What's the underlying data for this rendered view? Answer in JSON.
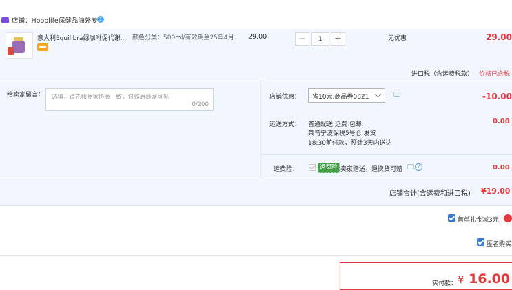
{
  "shop": {
    "name": "店铺：Hooplife保健品海外专",
    "badge": "1"
  },
  "product": {
    "title": "意大利Equilibra绿咖啡促代谢...",
    "sku": "颜色分类：500ml/有效期至25年4月",
    "unit_price": "29.00",
    "quantity": "1",
    "qty_minus": "−",
    "qty_plus": "+",
    "promotion": "无优惠",
    "total": "29.00"
  },
  "tax": {
    "label": "进口税（含运费税款）",
    "status": "价格已含税"
  },
  "message": {
    "label": "给卖家留言：",
    "placeholder": "选填，请先和商家协商一致，付款后商家可见",
    "counter": "0/200"
  },
  "coupon": {
    "label": "店铺优惠：",
    "selected": "省10元:商品券0821",
    "amount": "-10.00"
  },
  "shipping": {
    "label": "运送方式：",
    "lines": [
      "普通配送 运费 包邮",
      "菜鸟宁波保税5号仓 发货",
      "18:30前付款，预计3天内送达"
    ],
    "amount": "0.00"
  },
  "insurance": {
    "label": "运费险：",
    "tag": "运费险",
    "text": "卖家赠送，退换货可赔",
    "amount": "0.00"
  },
  "shop_total": {
    "label": "店铺合计(含运费和进口税)",
    "value": "¥19.00"
  },
  "options": {
    "gift_label": "首单礼金减3元",
    "anonymous_label": "匿名购买"
  },
  "payment": {
    "label": "实付款：",
    "currency": "¥",
    "value": "16.00"
  },
  "colors": {
    "accent": "#e4393c",
    "row_bg": "#f2f7ff",
    "check": "#3a7bd5"
  }
}
